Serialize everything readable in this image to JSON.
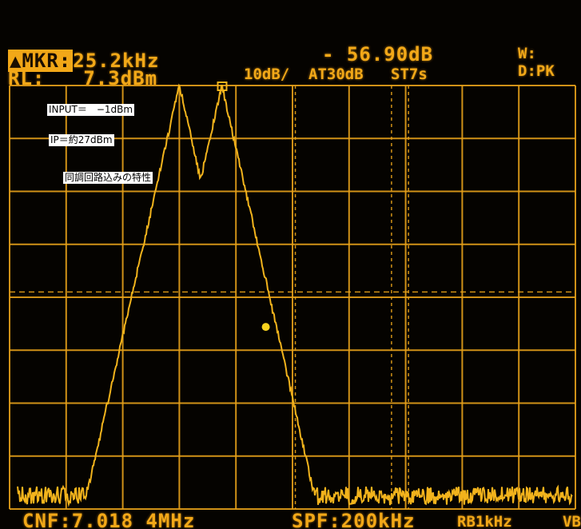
{
  "header": {
    "mkr_label": "▲MKR:",
    "mkr_value": "25.2kHz",
    "level_value": "- 56.90dB",
    "w_label": "W:",
    "rl_label": "RL:",
    "rl_value": "7.3dBm",
    "scale": "10dB/",
    "atten": "AT30dB",
    "sweep": "ST7s",
    "detector": "D:PK"
  },
  "footer": {
    "center_freq": "CNF:7.018 4MHz",
    "span": "SPF:200kHz",
    "rbw": "RB1kHz",
    "vb": "VB"
  },
  "notes": {
    "input": "INPUT＝　−1dBm",
    "ip": "IP＝約27dBm",
    "description": "同調回路込みの特性"
  },
  "colors": {
    "trace": "#f2b31c",
    "graticule": "#e6a11a",
    "background": "#050300"
  },
  "spectrum": {
    "noise_floor_div": 7.75,
    "peaks": [
      {
        "pos_div": 2.25,
        "level_div": 4.5,
        "role": "lower-third-order"
      },
      {
        "pos_div": 3.0,
        "level_div": 0.0,
        "role": "carrier-1"
      },
      {
        "pos_div": 3.75,
        "level_div": 0.0,
        "role": "carrier-2"
      },
      {
        "pos_div": 4.5,
        "level_div": 4.5,
        "role": "upper-third-order"
      }
    ]
  }
}
